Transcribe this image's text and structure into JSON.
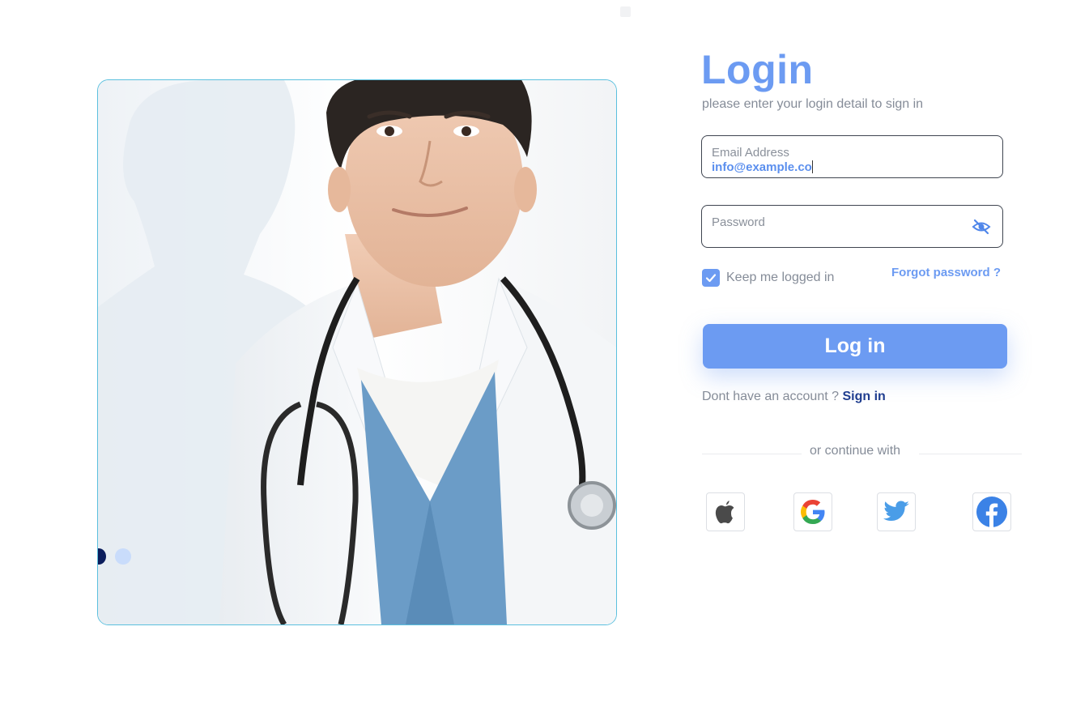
{
  "login": {
    "title": "Login",
    "subtitle": "please enter your login detail to sign in"
  },
  "email_field": {
    "label": "Email Address",
    "value": "info@example.co"
  },
  "password_field": {
    "label": "Password",
    "icon": "eye-off-icon"
  },
  "remember": {
    "label": "Keep me logged in",
    "checked": true
  },
  "forgot": {
    "label": "Forgot password  ?"
  },
  "login_button": {
    "label": "Log in"
  },
  "signup": {
    "prompt": "Dont have an account ?",
    "link": "Sign in"
  },
  "divider": {
    "text": "or continue with"
  },
  "social": [
    {
      "name": "apple",
      "icon": "apple-icon"
    },
    {
      "name": "google",
      "icon": "google-icon"
    },
    {
      "name": "twitter",
      "icon": "twitter-icon"
    },
    {
      "name": "facebook",
      "icon": "facebook-icon"
    }
  ],
  "carousel": {
    "total": 2,
    "active": 1
  },
  "colors": {
    "accent": "#6c9bf2",
    "link_dark": "#1f3d8f",
    "muted_text": "#858c98",
    "card_border": "#5bc0de"
  }
}
